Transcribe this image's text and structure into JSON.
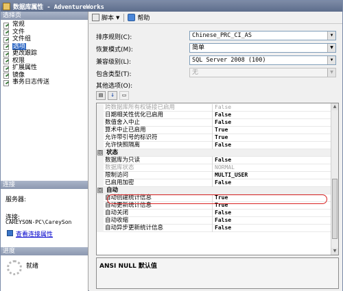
{
  "window": {
    "title": "数据库属性 - AdventureWorks"
  },
  "left": {
    "select_page_header": "选择页",
    "pages": [
      {
        "label": "常规",
        "selected": false
      },
      {
        "label": "文件",
        "selected": false
      },
      {
        "label": "文件组",
        "selected": false
      },
      {
        "label": "选项",
        "selected": true
      },
      {
        "label": "更改跟踪",
        "selected": false
      },
      {
        "label": "权限",
        "selected": false
      },
      {
        "label": "扩展属性",
        "selected": false
      },
      {
        "label": "镜像",
        "selected": false
      },
      {
        "label": "事务日志传送",
        "selected": false
      }
    ],
    "connection": {
      "header": "连接",
      "server_label": "服务器:",
      "server_value": "",
      "connection_label": "连接:",
      "connection_value": "CAREYSON-PC\\CareySon",
      "view_link": "查看连接属性"
    },
    "progress": {
      "header": "进度",
      "status": "就绪"
    }
  },
  "toolbar": {
    "script_label": "脚本",
    "help_label": "帮助"
  },
  "form": {
    "collation": {
      "label": "排序规则(C):",
      "value": "Chinese_PRC_CI_AS"
    },
    "recovery": {
      "label": "恢复模式(M):",
      "value": "简单"
    },
    "compat": {
      "label": "兼容级别(L):",
      "value": "SQL Server 2008 (100)"
    },
    "containment": {
      "label": "包含类型(T):",
      "value": "无"
    },
    "other_label": "其他选项(O):"
  },
  "grid": {
    "rows": [
      {
        "type": "prop",
        "name": "跨数据库所有权链接已启用",
        "value": "False",
        "dim": true
      },
      {
        "type": "prop",
        "name": "日期相关性优化已启用",
        "value": "False"
      },
      {
        "type": "prop",
        "name": "数值舍入中止",
        "value": "False"
      },
      {
        "type": "prop",
        "name": "算术中止已启用",
        "value": "True"
      },
      {
        "type": "prop",
        "name": "允许带引号的标识符",
        "value": "True"
      },
      {
        "type": "prop",
        "name": "允许快照隔离",
        "value": "False"
      },
      {
        "type": "cat",
        "name": "状态",
        "toggle": "⊟"
      },
      {
        "type": "prop",
        "name": "数据库为只读",
        "value": "False"
      },
      {
        "type": "prop",
        "name": "数据库状态",
        "value": "NORMAL",
        "dim": true
      },
      {
        "type": "prop",
        "name": "限制访问",
        "value": "MULTI_USER"
      },
      {
        "type": "prop",
        "name": "已启用加密",
        "value": "False"
      },
      {
        "type": "cat",
        "name": "自动",
        "toggle": "⊟"
      },
      {
        "type": "prop",
        "name": "自动创建统计信息",
        "value": "True",
        "highlight": true
      },
      {
        "type": "prop",
        "name": "自动更新统计信息",
        "value": "True"
      },
      {
        "type": "prop",
        "name": "自动关闭",
        "value": "False"
      },
      {
        "type": "prop",
        "name": "自动收缩",
        "value": "False"
      },
      {
        "type": "prop",
        "name": "自动异步更新统计信息",
        "value": "False"
      }
    ]
  },
  "description": {
    "title": "ANSI NULL 默认值"
  },
  "colors": {
    "accent": "#316ac5",
    "highlight_ring": "#d82020"
  }
}
